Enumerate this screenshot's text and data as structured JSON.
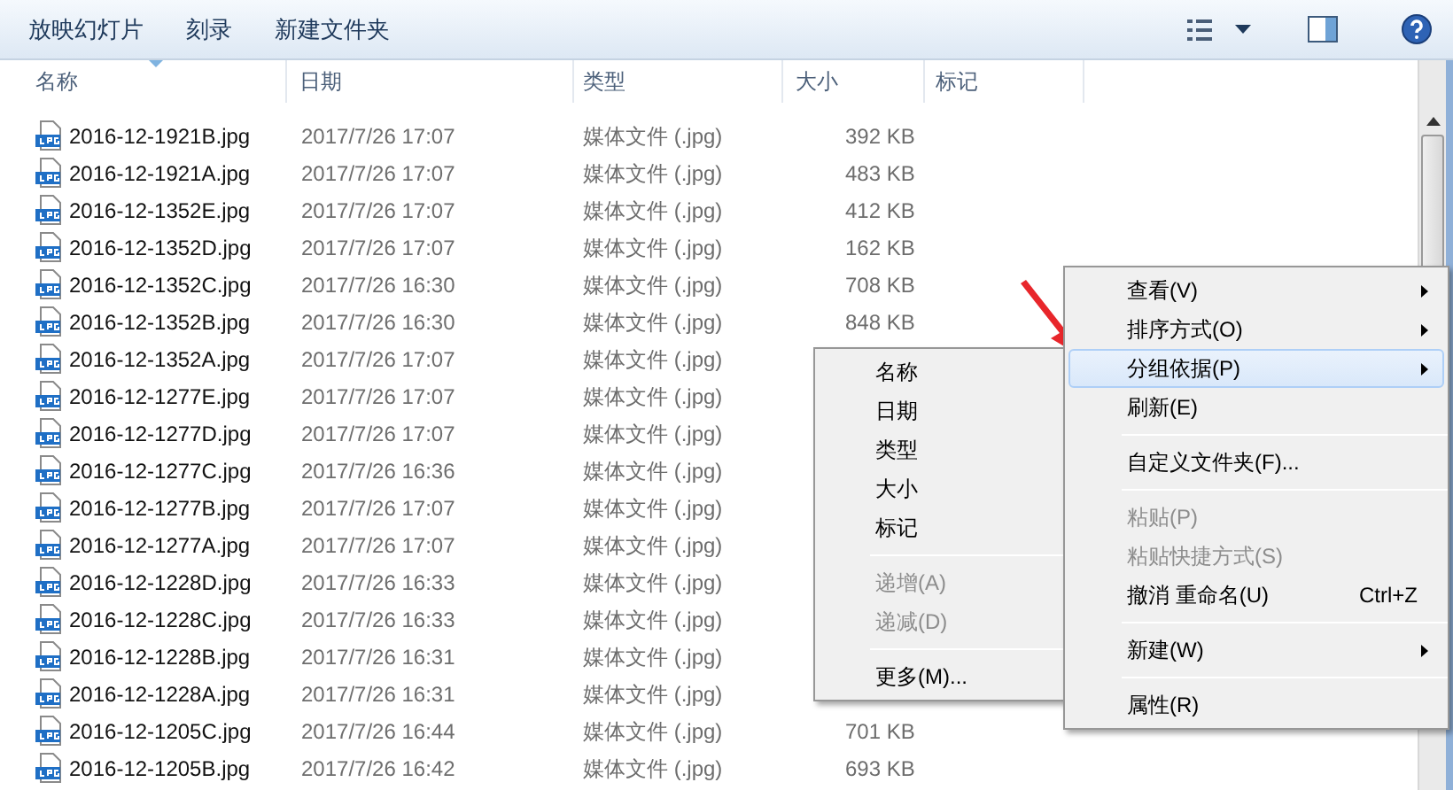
{
  "toolbar": {
    "buttons": [
      "放映幻灯片",
      "刻录",
      "新建文件夹"
    ]
  },
  "columns": [
    "名称",
    "日期",
    "类型",
    "大小",
    "标记"
  ],
  "files": [
    {
      "name": "2016-12-1921B.jpg",
      "date": "2017/7/26 17:07",
      "type": "媒体文件 (.jpg)",
      "size": "392 KB"
    },
    {
      "name": "2016-12-1921A.jpg",
      "date": "2017/7/26 17:07",
      "type": "媒体文件 (.jpg)",
      "size": "483 KB"
    },
    {
      "name": "2016-12-1352E.jpg",
      "date": "2017/7/26 17:07",
      "type": "媒体文件 (.jpg)",
      "size": "412 KB"
    },
    {
      "name": "2016-12-1352D.jpg",
      "date": "2017/7/26 17:07",
      "type": "媒体文件 (.jpg)",
      "size": "162 KB"
    },
    {
      "name": "2016-12-1352C.jpg",
      "date": "2017/7/26 16:30",
      "type": "媒体文件 (.jpg)",
      "size": "708 KB"
    },
    {
      "name": "2016-12-1352B.jpg",
      "date": "2017/7/26 16:30",
      "type": "媒体文件 (.jpg)",
      "size": "848 KB"
    },
    {
      "name": "2016-12-1352A.jpg",
      "date": "2017/7/26 17:07",
      "type": "媒体文件 (.jpg)"
    },
    {
      "name": "2016-12-1277E.jpg",
      "date": "2017/7/26 17:07",
      "type": "媒体文件 (.jpg)"
    },
    {
      "name": "2016-12-1277D.jpg",
      "date": "2017/7/26 17:07",
      "type": "媒体文件 (.jpg)"
    },
    {
      "name": "2016-12-1277C.jpg",
      "date": "2017/7/26 16:36",
      "type": "媒体文件 (.jpg)"
    },
    {
      "name": "2016-12-1277B.jpg",
      "date": "2017/7/26 17:07",
      "type": "媒体文件 (.jpg)"
    },
    {
      "name": "2016-12-1277A.jpg",
      "date": "2017/7/26 17:07",
      "type": "媒体文件 (.jpg)"
    },
    {
      "name": "2016-12-1228D.jpg",
      "date": "2017/7/26 16:33",
      "type": "媒体文件 (.jpg)"
    },
    {
      "name": "2016-12-1228C.jpg",
      "date": "2017/7/26 16:33",
      "type": "媒体文件 (.jpg)"
    },
    {
      "name": "2016-12-1228B.jpg",
      "date": "2017/7/26 16:31",
      "type": "媒体文件 (.jpg)"
    },
    {
      "name": "2016-12-1228A.jpg",
      "date": "2017/7/26 16:31",
      "type": "媒体文件 (.jpg)"
    },
    {
      "name": "2016-12-1205C.jpg",
      "date": "2017/7/26 16:44",
      "type": "媒体文件 (.jpg)",
      "size": "701 KB"
    },
    {
      "name": "2016-12-1205B.jpg",
      "date": "2017/7/26 16:42",
      "type": "媒体文件 (.jpg)",
      "size": "693 KB"
    }
  ],
  "context_menu": {
    "items": [
      {
        "kind": "item",
        "label": "查看(V)",
        "submenu": true,
        "disabled": false,
        "selected": false
      },
      {
        "kind": "item",
        "label": "排序方式(O)",
        "submenu": true,
        "disabled": false,
        "selected": false
      },
      {
        "kind": "item",
        "label": "分组依据(P)",
        "submenu": true,
        "disabled": false,
        "selected": true
      },
      {
        "kind": "item",
        "label": "刷新(E)",
        "submenu": false,
        "disabled": false,
        "selected": false
      },
      {
        "kind": "separator"
      },
      {
        "kind": "item",
        "label": "自定义文件夹(F)...",
        "submenu": false,
        "disabled": false,
        "selected": false
      },
      {
        "kind": "separator"
      },
      {
        "kind": "item",
        "label": "粘贴(P)",
        "submenu": false,
        "disabled": true,
        "selected": false
      },
      {
        "kind": "item",
        "label": "粘贴快捷方式(S)",
        "submenu": false,
        "disabled": true,
        "selected": false
      },
      {
        "kind": "item",
        "label": "撤消 重命名(U)",
        "shortcut": "Ctrl+Z",
        "submenu": false,
        "disabled": false,
        "selected": false
      },
      {
        "kind": "separator"
      },
      {
        "kind": "item",
        "label": "新建(W)",
        "submenu": true,
        "disabled": false,
        "selected": false
      },
      {
        "kind": "separator"
      },
      {
        "kind": "item",
        "label": "属性(R)",
        "submenu": false,
        "disabled": false,
        "selected": false
      }
    ]
  },
  "group_by_submenu": {
    "items": [
      {
        "kind": "item",
        "label": "名称",
        "disabled": false
      },
      {
        "kind": "item",
        "label": "日期",
        "disabled": false
      },
      {
        "kind": "item",
        "label": "类型",
        "disabled": false
      },
      {
        "kind": "item",
        "label": "大小",
        "disabled": false
      },
      {
        "kind": "item",
        "label": "标记",
        "disabled": false
      },
      {
        "kind": "separator"
      },
      {
        "kind": "item",
        "label": "递增(A)",
        "disabled": true
      },
      {
        "kind": "item",
        "label": "递减(D)",
        "disabled": true
      },
      {
        "kind": "separator"
      },
      {
        "kind": "item",
        "label": "更多(M)...",
        "disabled": false
      }
    ]
  }
}
